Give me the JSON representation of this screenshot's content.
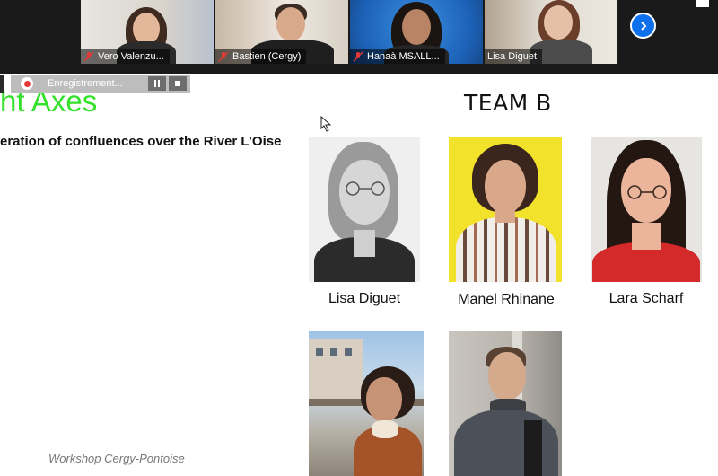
{
  "video_strip": {
    "participants": [
      {
        "name": "Vero Valenzu...",
        "muted": true,
        "active": false
      },
      {
        "name": "Bastien (Cergy)",
        "muted": true,
        "active": false
      },
      {
        "name": "Hanaà MSALL...",
        "muted": true,
        "active": false
      },
      {
        "name": "Lisa Diguet",
        "muted": false,
        "active": true
      }
    ],
    "next_icon": "chevron-right-icon"
  },
  "recording": {
    "label": "Enregistrement...",
    "pause_icon": "pause-icon",
    "stop_icon": "stop-icon"
  },
  "slide": {
    "title": "ht Axes",
    "subtitle": "eration of confluences over the River L’Oise",
    "team_heading": "TEAM B",
    "footer": "Workshop Cergy-Pontoise",
    "title_color": "#33e02a",
    "members": [
      {
        "name": "Lisa Diguet"
      },
      {
        "name": "Manel Rhinane"
      },
      {
        "name": "Lara Scharf"
      }
    ]
  }
}
